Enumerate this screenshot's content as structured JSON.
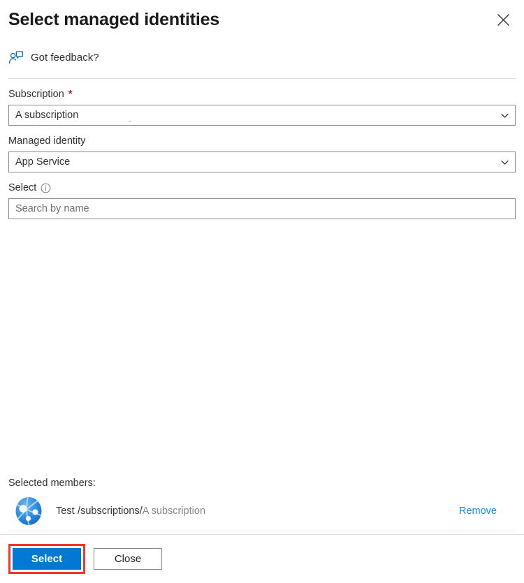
{
  "dialog": {
    "title": "Select managed identities",
    "close_icon": "close-icon"
  },
  "feedback": {
    "label": "Got feedback?",
    "icon": "feedback-person-icon"
  },
  "form": {
    "subscription": {
      "label": "Subscription",
      "required_marker": "*",
      "value": "A subscription",
      "chevron_icon": "chevron-down-icon"
    },
    "managed_identity": {
      "label": "Managed identity",
      "value": "App Service",
      "chevron_icon": "chevron-down-icon"
    },
    "select": {
      "label": "Select",
      "info_icon": "info-icon",
      "placeholder": "Search by name",
      "value": ""
    }
  },
  "selected_members": {
    "title": "Selected members:",
    "items": [
      {
        "avatar_icon": "app-service-icon",
        "name": "Test",
        "path": "/subscriptions/",
        "scope": "A subscription",
        "remove_label": "Remove"
      }
    ]
  },
  "footer": {
    "primary_label": "Select",
    "secondary_label": "Close"
  },
  "colors": {
    "accent": "#0078d4",
    "link": "#1a86e0",
    "required": "#a4262c",
    "highlight": "#f2352a",
    "border": "#8a8886",
    "divider": "#e1dfdd"
  }
}
